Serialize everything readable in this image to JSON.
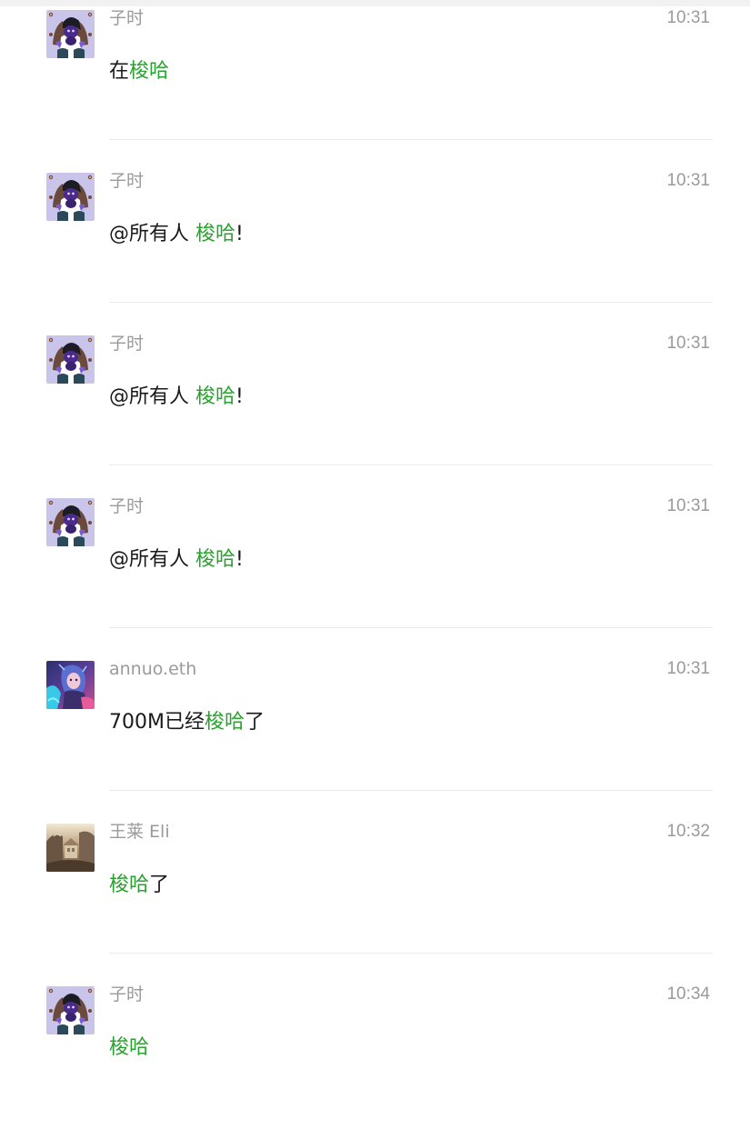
{
  "colors": {
    "keyword": "#2aa22f",
    "meta_text": "#9a9a9a",
    "body_text": "#1a1a1a",
    "divider": "#ececec"
  },
  "messages": [
    {
      "sender": "子时",
      "time": "10:31",
      "avatar": "dark-character-avatar",
      "parts": [
        {
          "text": "在",
          "highlight": false
        },
        {
          "text": "梭哈",
          "highlight": true
        }
      ]
    },
    {
      "sender": "子时",
      "time": "10:31",
      "avatar": "dark-character-avatar",
      "parts": [
        {
          "text": "@所有人 ",
          "highlight": false
        },
        {
          "text": "梭哈",
          "highlight": true
        },
        {
          "text": "!",
          "highlight": false
        }
      ]
    },
    {
      "sender": "子时",
      "time": "10:31",
      "avatar": "dark-character-avatar",
      "parts": [
        {
          "text": "@所有人 ",
          "highlight": false
        },
        {
          "text": "梭哈",
          "highlight": true
        },
        {
          "text": "!",
          "highlight": false
        }
      ]
    },
    {
      "sender": "子时",
      "time": "10:31",
      "avatar": "dark-character-avatar",
      "parts": [
        {
          "text": "@所有人 ",
          "highlight": false
        },
        {
          "text": "梭哈",
          "highlight": true
        },
        {
          "text": "!",
          "highlight": false
        }
      ]
    },
    {
      "sender": "annuo.eth",
      "time": "10:31",
      "avatar": "anime-girl-avatar",
      "parts": [
        {
          "text": "700M已经",
          "highlight": false
        },
        {
          "text": "梭哈",
          "highlight": true
        },
        {
          "text": "了",
          "highlight": false
        }
      ]
    },
    {
      "sender": "王莱 Eli",
      "time": "10:32",
      "avatar": "landscape-photo-avatar",
      "parts": [
        {
          "text": "梭哈",
          "highlight": true
        },
        {
          "text": "了",
          "highlight": false
        }
      ]
    },
    {
      "sender": "子时",
      "time": "10:34",
      "avatar": "dark-character-avatar",
      "parts": [
        {
          "text": "梭哈",
          "highlight": true
        }
      ]
    }
  ]
}
